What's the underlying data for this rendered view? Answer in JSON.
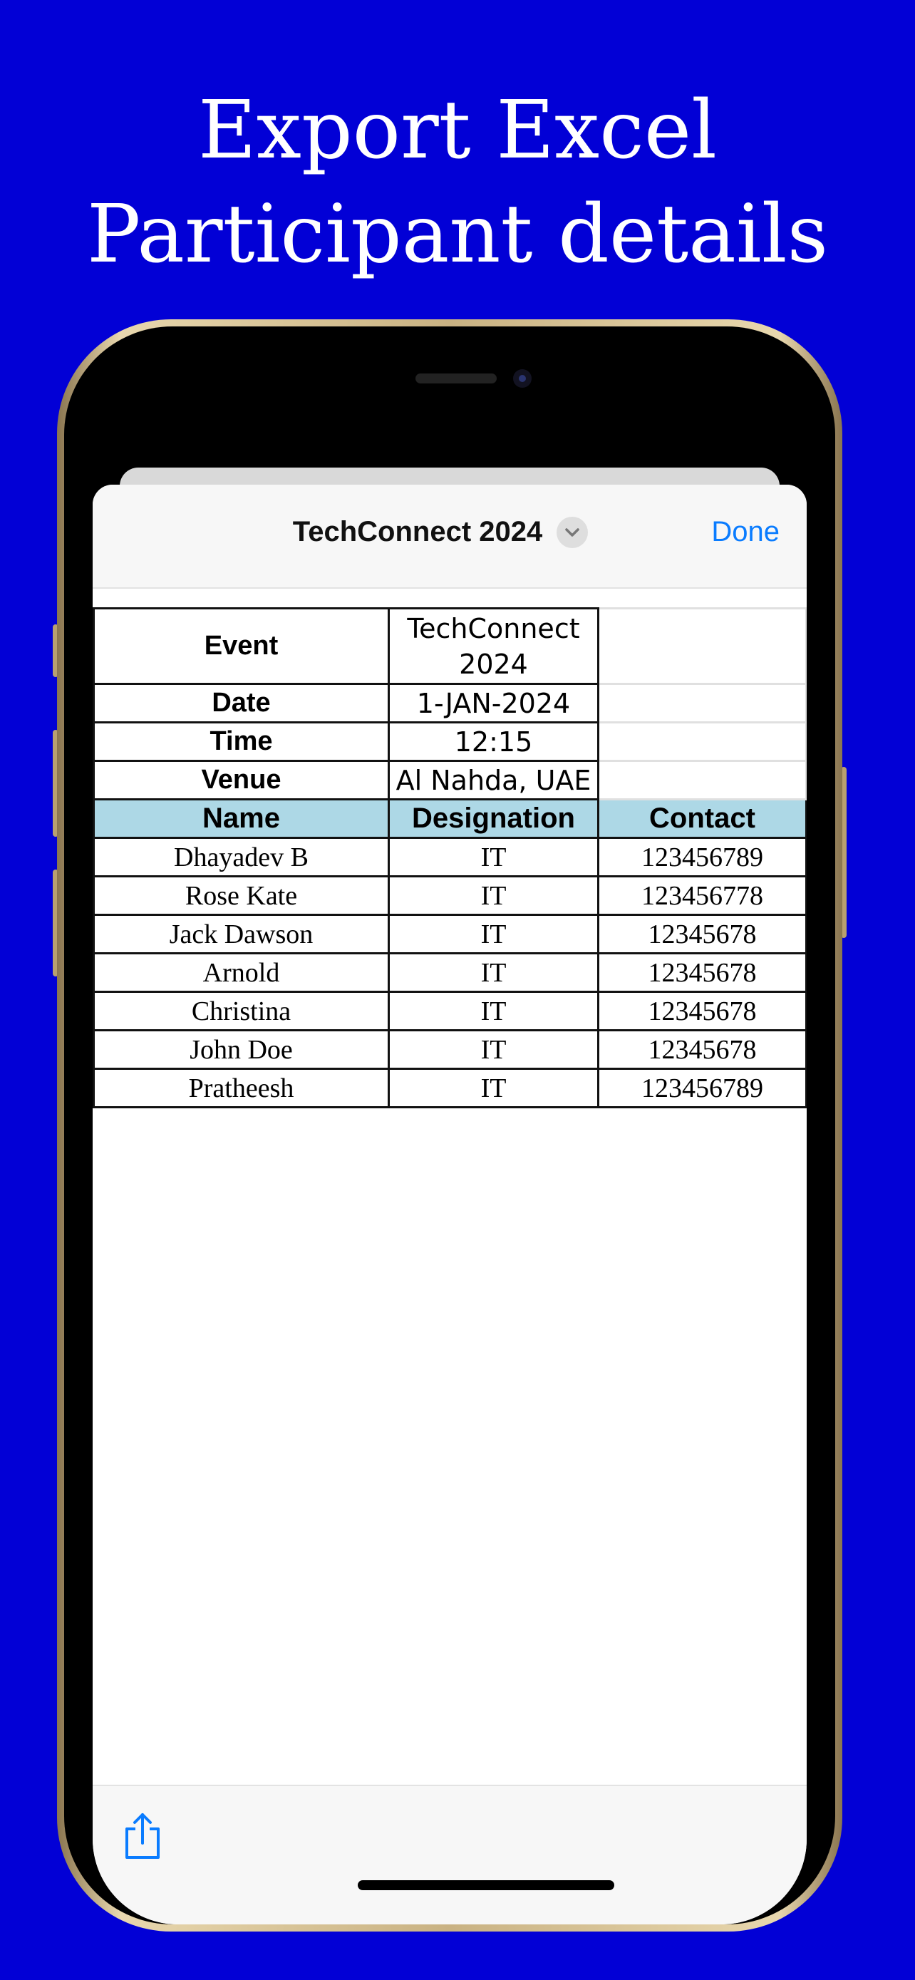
{
  "headline": {
    "line1": "Export Excel",
    "line2": "Participant details"
  },
  "nav": {
    "title": "TechConnect 2024",
    "done_label": "Done"
  },
  "event_info": [
    {
      "label": "Event",
      "value_line1": "TechConnect",
      "value_line2": "2024"
    },
    {
      "label": "Date",
      "value": "1-JAN-2024"
    },
    {
      "label": "Time",
      "value": "12:15"
    },
    {
      "label": "Venue",
      "value": "Al Nahda, UAE"
    }
  ],
  "table": {
    "headers": [
      "Name",
      "Designation",
      "Contact"
    ],
    "rows": [
      [
        "Dhayadev B",
        "IT",
        "123456789"
      ],
      [
        "Rose Kate",
        "IT",
        "123456778"
      ],
      [
        "Jack Dawson",
        "IT",
        "12345678"
      ],
      [
        "Arnold",
        "IT",
        "12345678"
      ],
      [
        "Christina",
        "IT",
        "12345678"
      ],
      [
        "John Doe",
        "IT",
        "12345678"
      ],
      [
        "Pratheesh",
        "IT",
        "123456789"
      ]
    ],
    "header_color": "#add8e6"
  },
  "toolbar": {
    "share_icon": "share-icon"
  },
  "colors": {
    "background": "#0200d6",
    "accent": "#0a7cff"
  }
}
